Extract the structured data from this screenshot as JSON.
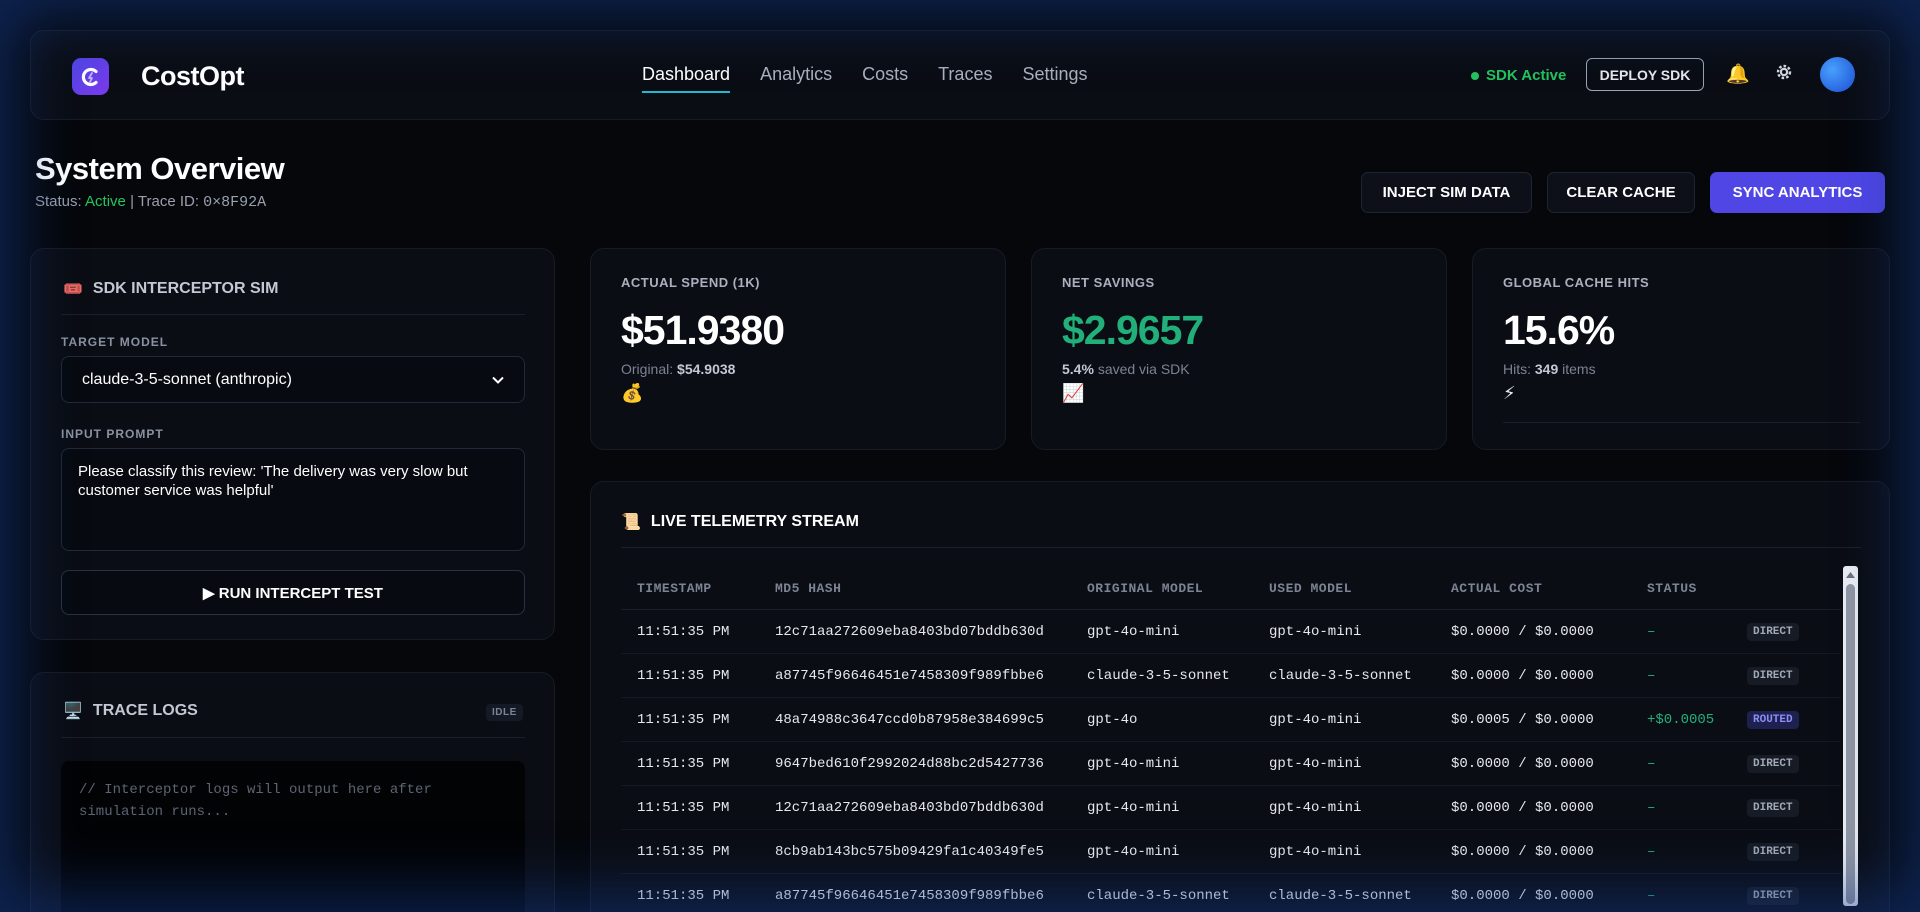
{
  "header": {
    "brand": "CostOpt",
    "nav": [
      "Dashboard",
      "Analytics",
      "Costs",
      "Traces",
      "Settings"
    ],
    "active_nav": "Dashboard",
    "sdk_status": "SDK Active",
    "deploy_label": "DEPLOY SDK",
    "icons": [
      "bell-icon",
      "gear-icon",
      "avatar"
    ]
  },
  "page": {
    "title": "System Overview",
    "status_prefix": "Status:",
    "status_value": "Active",
    "trace_prefix": "| Trace ID:",
    "trace_id": "0×8F92A",
    "actions": [
      "INJECT SIM DATA",
      "CLEAR CACHE",
      "SYNC ANALYTICS"
    ]
  },
  "interceptor": {
    "title": "SDK INTERCEPTOR SIM",
    "model_label": "TARGET MODEL",
    "model_value": "claude-3-5-sonnet (anthropic)",
    "prompt_label": "INPUT PROMPT",
    "prompt_value": "Please classify this review: 'The delivery was very slow but customer service was helpful'",
    "run_label": "▶ RUN INTERCEPT TEST"
  },
  "trace_logs": {
    "title": "TRACE LOGS",
    "badge": "IDLE",
    "placeholder": "// Interceptor logs will output here after simulation runs..."
  },
  "stats": {
    "spend": {
      "label": "ACTUAL SPEND (1K)",
      "value": "$51.9380",
      "sub_prefix": "Original:",
      "sub_value": "$54.9038",
      "icon": "💰"
    },
    "savings": {
      "label": "NET SAVINGS",
      "value": "$2.9657",
      "sub_value": "5.4%",
      "sub_suffix": "saved via SDK",
      "icon": "📈"
    },
    "cache": {
      "label": "GLOBAL CACHE HITS",
      "value": "15.6%",
      "sub_prefix": "Hits:",
      "sub_value": "349",
      "sub_suffix": "items",
      "icon": "⚡"
    }
  },
  "telemetry": {
    "title": "LIVE TELEMETRY STREAM",
    "columns": [
      "TIMESTAMP",
      "MD5 HASH",
      "ORIGINAL MODEL",
      "USED MODEL",
      "ACTUAL COST",
      "STATUS"
    ],
    "rows": [
      {
        "time": "11:51:35 PM",
        "hash": "12c71aa272609eba8403bd07bddb630d",
        "original": "gpt-4o-mini",
        "used": "gpt-4o-mini",
        "cost": "$0.0000 / $0.0000",
        "savings": "–",
        "status": "DIRECT"
      },
      {
        "time": "11:51:35 PM",
        "hash": "a87745f96646451e7458309f989fbbe6",
        "original": "claude-3-5-sonnet",
        "used": "claude-3-5-sonnet",
        "cost": "$0.0000 / $0.0000",
        "savings": "–",
        "status": "DIRECT"
      },
      {
        "time": "11:51:35 PM",
        "hash": "48a74988c3647ccd0b87958e384699c5",
        "original": "gpt-4o",
        "used": "gpt-4o-mini",
        "cost": "$0.0005 / $0.0000",
        "savings": "+$0.0005",
        "status": "ROUTED"
      },
      {
        "time": "11:51:35 PM",
        "hash": "9647bed610f2992024d88bc2d5427736",
        "original": "gpt-4o-mini",
        "used": "gpt-4o-mini",
        "cost": "$0.0000 / $0.0000",
        "savings": "–",
        "status": "DIRECT"
      },
      {
        "time": "11:51:35 PM",
        "hash": "12c71aa272609eba8403bd07bddb630d",
        "original": "gpt-4o-mini",
        "used": "gpt-4o-mini",
        "cost": "$0.0000 / $0.0000",
        "savings": "–",
        "status": "DIRECT"
      },
      {
        "time": "11:51:35 PM",
        "hash": "8cb9ab143bc575b09429fa1c40349fe5",
        "original": "gpt-4o-mini",
        "used": "gpt-4o-mini",
        "cost": "$0.0000 / $0.0000",
        "savings": "–",
        "status": "DIRECT"
      },
      {
        "time": "11:51:35 PM",
        "hash": "a87745f96646451e7458309f989fbbe6",
        "original": "claude-3-5-sonnet",
        "used": "claude-3-5-sonnet",
        "cost": "$0.0000 / $0.0000",
        "savings": "–",
        "status": "DIRECT"
      }
    ]
  },
  "colors": {
    "accent": "#4f46e5",
    "success": "#22c55e",
    "teal": "#22b8cf"
  }
}
